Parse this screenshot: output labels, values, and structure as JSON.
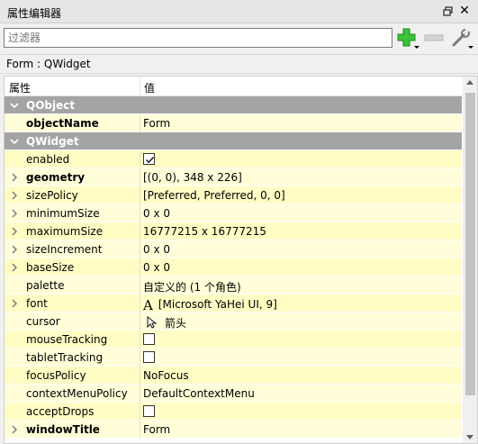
{
  "window": {
    "title": "属性编辑器",
    "close_glyph": "✕"
  },
  "filter": {
    "placeholder": "过滤器",
    "value": ""
  },
  "toolbar": {
    "add_icon": "plus-icon",
    "remove_icon": "minus-icon",
    "config_icon": "wrench-icon"
  },
  "object_label": "Form : QWidget",
  "columns": {
    "property": "属性",
    "value": "值"
  },
  "rows": [
    {
      "kind": "group",
      "name": "QObject",
      "expanded": true
    },
    {
      "kind": "prop",
      "name": "objectName",
      "value": "Form",
      "bold": true,
      "expandable": false
    },
    {
      "kind": "group",
      "name": "QWidget",
      "expanded": true
    },
    {
      "kind": "prop",
      "name": "enabled",
      "checkbox": true,
      "checked": true,
      "expandable": false
    },
    {
      "kind": "prop",
      "name": "geometry",
      "value": "[(0, 0), 348 x 226]",
      "bold": true,
      "expandable": true
    },
    {
      "kind": "prop",
      "name": "sizePolicy",
      "value": "[Preferred, Preferred, 0, 0]",
      "expandable": true
    },
    {
      "kind": "prop",
      "name": "minimumSize",
      "value": "0 x 0",
      "expandable": true
    },
    {
      "kind": "prop",
      "name": "maximumSize",
      "value": "16777215 x 16777215",
      "expandable": true
    },
    {
      "kind": "prop",
      "name": "sizeIncrement",
      "value": "0 x 0",
      "expandable": true
    },
    {
      "kind": "prop",
      "name": "baseSize",
      "value": "0 x 0",
      "expandable": true
    },
    {
      "kind": "prop",
      "name": "palette",
      "value": "自定义的 (1 个角色)",
      "expandable": false
    },
    {
      "kind": "prop",
      "name": "font",
      "value": "[Microsoft YaHei UI, 9]",
      "icon": "font",
      "icon_glyph": "A",
      "expandable": true
    },
    {
      "kind": "prop",
      "name": "cursor",
      "value": "箭头",
      "icon": "cursor",
      "expandable": false
    },
    {
      "kind": "prop",
      "name": "mouseTracking",
      "checkbox": true,
      "checked": false,
      "expandable": false
    },
    {
      "kind": "prop",
      "name": "tabletTracking",
      "checkbox": true,
      "checked": false,
      "expandable": false
    },
    {
      "kind": "prop",
      "name": "focusPolicy",
      "value": "NoFocus",
      "expandable": false
    },
    {
      "kind": "prop",
      "name": "contextMenuPolicy",
      "value": "DefaultContextMenu",
      "expandable": false
    },
    {
      "kind": "prop",
      "name": "acceptDrops",
      "checkbox": true,
      "checked": false,
      "expandable": false
    },
    {
      "kind": "prop",
      "name": "windowTitle",
      "value": "Form",
      "bold": true,
      "expandable": true
    }
  ],
  "colors": {
    "group_bg": "#a4a4a4",
    "row_bg": "#fffed8",
    "row_alt_bg": "#fffcc4",
    "add_green": "#3cc23c"
  }
}
